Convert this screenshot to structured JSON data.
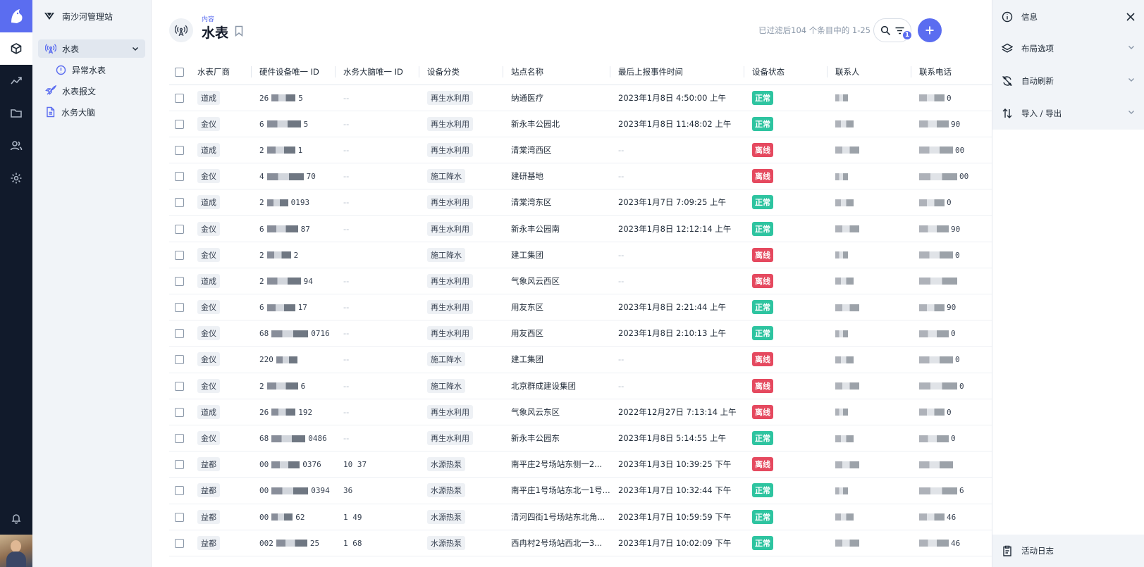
{
  "nav": {
    "station": "南沙河管理站",
    "items": [
      {
        "label": "水表"
      },
      {
        "label": "异常水表"
      },
      {
        "label": "水表报文"
      },
      {
        "label": "水务大脑"
      }
    ]
  },
  "header": {
    "crumb": "内容",
    "title": "水表",
    "count": "已过滤后104 个条目中的 1-25",
    "filter_badge": "1"
  },
  "table": {
    "columns": [
      "水表厂商",
      "硬件设备唯一 ID",
      "水务大脑唯一 ID",
      "设备分类",
      "站点名称",
      "最后上报事件时间",
      "设备状态",
      "联系人",
      "联系电话"
    ],
    "rows": [
      {
        "vendor": "道成",
        "hw_pre": "26",
        "hw_suf": "5",
        "brain": "--",
        "category": "再生水利用",
        "site": "纳通医疗",
        "time": "2023年1月8日 4:50:00 上午",
        "status": "正常",
        "phone_suf": "0"
      },
      {
        "vendor": "金仪",
        "hw_pre": "6",
        "hw_suf": "5",
        "brain": "--",
        "category": "再生水利用",
        "site": "新永丰公园北",
        "time": "2023年1月8日 11:48:02 上午",
        "status": "正常",
        "phone_suf": "90"
      },
      {
        "vendor": "道成",
        "hw_pre": "2",
        "hw_suf": "1",
        "brain": "--",
        "category": "再生水利用",
        "site": "清棠湾西区",
        "time": "--",
        "status": "离线",
        "phone_suf": "00"
      },
      {
        "vendor": "金仪",
        "hw_pre": "4",
        "hw_suf": "70",
        "brain": "--",
        "category": "施工降水",
        "site": "建研基地",
        "time": "--",
        "status": "离线",
        "phone_suf": "00"
      },
      {
        "vendor": "道成",
        "hw_pre": "2",
        "hw_suf": "0193",
        "brain": "--",
        "category": "再生水利用",
        "site": "清棠湾东区",
        "time": "2023年1月7日 7:09:25 上午",
        "status": "正常",
        "phone_suf": "0"
      },
      {
        "vendor": "金仪",
        "hw_pre": "6",
        "hw_suf": "87",
        "brain": "--",
        "category": "再生水利用",
        "site": "新永丰公园南",
        "time": "2023年1月8日 12:12:14 上午",
        "status": "正常",
        "phone_suf": "90"
      },
      {
        "vendor": "金仪",
        "hw_pre": "2",
        "hw_suf": "2",
        "brain": "",
        "category": "施工降水",
        "site": "建工集团",
        "time": "--",
        "status": "离线",
        "phone_suf": "0"
      },
      {
        "vendor": "道成",
        "hw_pre": "2",
        "hw_suf": "94",
        "brain": "--",
        "category": "再生水利用",
        "site": "气象风云西区",
        "time": "--",
        "status": "离线",
        "phone_suf": ""
      },
      {
        "vendor": "金仪",
        "hw_pre": "6",
        "hw_suf": "17",
        "brain": "--",
        "category": "再生水利用",
        "site": "用友东区",
        "time": "2023年1月8日 2:21:44 上午",
        "status": "正常",
        "phone_suf": "90"
      },
      {
        "vendor": "金仪",
        "hw_pre": "68",
        "hw_suf": "0716",
        "brain": "--",
        "category": "再生水利用",
        "site": "用友西区",
        "time": "2023年1月8日 2:10:13 上午",
        "status": "正常",
        "phone_suf": "0"
      },
      {
        "vendor": "金仪",
        "hw_pre": "220",
        "hw_suf": "",
        "brain": "--",
        "category": "施工降水",
        "site": "建工集团",
        "time": "--",
        "status": "离线",
        "phone_suf": "0"
      },
      {
        "vendor": "金仪",
        "hw_pre": "2",
        "hw_suf": "6",
        "brain": "--",
        "category": "施工降水",
        "site": "北京群成建设集团",
        "time": "--",
        "status": "离线",
        "phone_suf": "0"
      },
      {
        "vendor": "道成",
        "hw_pre": "26",
        "hw_suf": "192",
        "brain": "--",
        "category": "再生水利用",
        "site": "气象风云东区",
        "time": "2022年12月27日 7:13:14 上午",
        "status": "离线",
        "phone_suf": "0"
      },
      {
        "vendor": "金仪",
        "hw_pre": "68",
        "hw_suf": "0486",
        "brain": "--",
        "category": "再生水利用",
        "site": "新永丰公园东",
        "time": "2023年1月8日 5:14:55 上午",
        "status": "正常",
        "phone_suf": "0"
      },
      {
        "vendor": "益都",
        "hw_pre": "00",
        "hw_suf": "0376",
        "brain": "10 37",
        "category": "水源热泵",
        "site": "南平庄2号场站东侧一2...",
        "time": "2023年1月3日 10:39:25 下午",
        "status": "离线",
        "phone_suf": ""
      },
      {
        "vendor": "益都",
        "hw_pre": "00",
        "hw_suf": "0394",
        "brain": "36",
        "category": "水源热泵",
        "site": "南平庄1号场站东北一1号...",
        "time": "2023年1月7日 10:32:44 下午",
        "status": "正常",
        "phone_suf": "6"
      },
      {
        "vendor": "益都",
        "hw_pre": "00",
        "hw_suf": "62",
        "brain": "1 49",
        "category": "水源热泵",
        "site": "清河四街1号场站东北角...",
        "time": "2023年1月7日 10:59:59 下午",
        "status": "正常",
        "phone_suf": "46"
      },
      {
        "vendor": "益都",
        "hw_pre": "002",
        "hw_suf": "25",
        "brain": "1 68",
        "category": "水源热泵",
        "site": "西冉村2号场站西北一3...",
        "time": "2023年1月7日 10:02:09 下午",
        "status": "正常",
        "phone_suf": "46"
      }
    ]
  },
  "rpanel": {
    "info": "信息",
    "layout": "布局选项",
    "refresh": "自动刷新",
    "io": "导入 / 导出",
    "log": "活动日志"
  },
  "colors": {
    "accent": "#5b6df0",
    "ok": "#2ec4a0",
    "offline": "#e5495f",
    "rail": "#111a2b"
  }
}
